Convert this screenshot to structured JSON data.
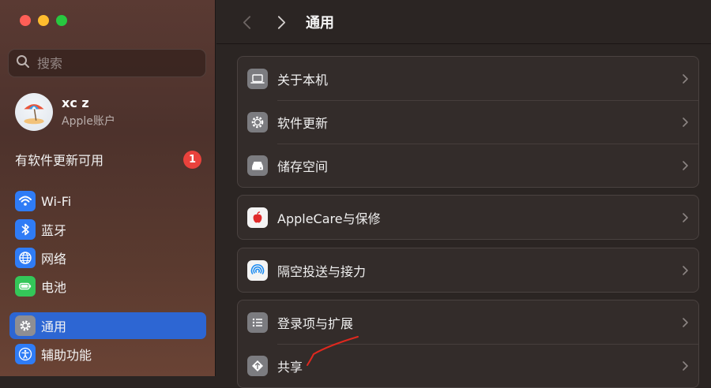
{
  "sidebar": {
    "search_placeholder": "搜索",
    "account": {
      "name": "xc z",
      "subtitle": "Apple账户"
    },
    "update_notice": {
      "label": "有软件更新可用",
      "badge": "1"
    },
    "items": [
      {
        "label": "Wi-Fi",
        "icon": "wifi-icon",
        "color": "#2f7cf6"
      },
      {
        "label": "蓝牙",
        "icon": "bluetooth-icon",
        "color": "#2f7cf6"
      },
      {
        "label": "网络",
        "icon": "globe-icon",
        "color": "#2f7cf6"
      },
      {
        "label": "电池",
        "icon": "battery-icon",
        "color": "#34c759"
      },
      {
        "label": "通用",
        "icon": "gear-icon",
        "color": "#8e8e93",
        "active": true
      },
      {
        "label": "辅助功能",
        "icon": "accessibility-icon",
        "color": "#2f7cf6"
      }
    ]
  },
  "toolbar": {
    "title": "通用"
  },
  "groups": [
    [
      {
        "label": "关于本机",
        "icon": "laptop-icon"
      },
      {
        "label": "软件更新",
        "icon": "software-update-gear-icon"
      },
      {
        "label": "储存空间",
        "icon": "storage-drive-icon"
      }
    ],
    [
      {
        "label": "AppleCare与保修",
        "icon": "apple-logo-icon"
      }
    ],
    [
      {
        "label": "隔空投送与接力",
        "icon": "airdrop-icon"
      }
    ],
    [
      {
        "label": "登录项与扩展",
        "icon": "list-icon"
      },
      {
        "label": "共享",
        "icon": "sharing-icon"
      }
    ]
  ],
  "colors": {
    "accent": "#2d66d3",
    "badge": "#e9423c",
    "annotation": "#e0281e"
  }
}
